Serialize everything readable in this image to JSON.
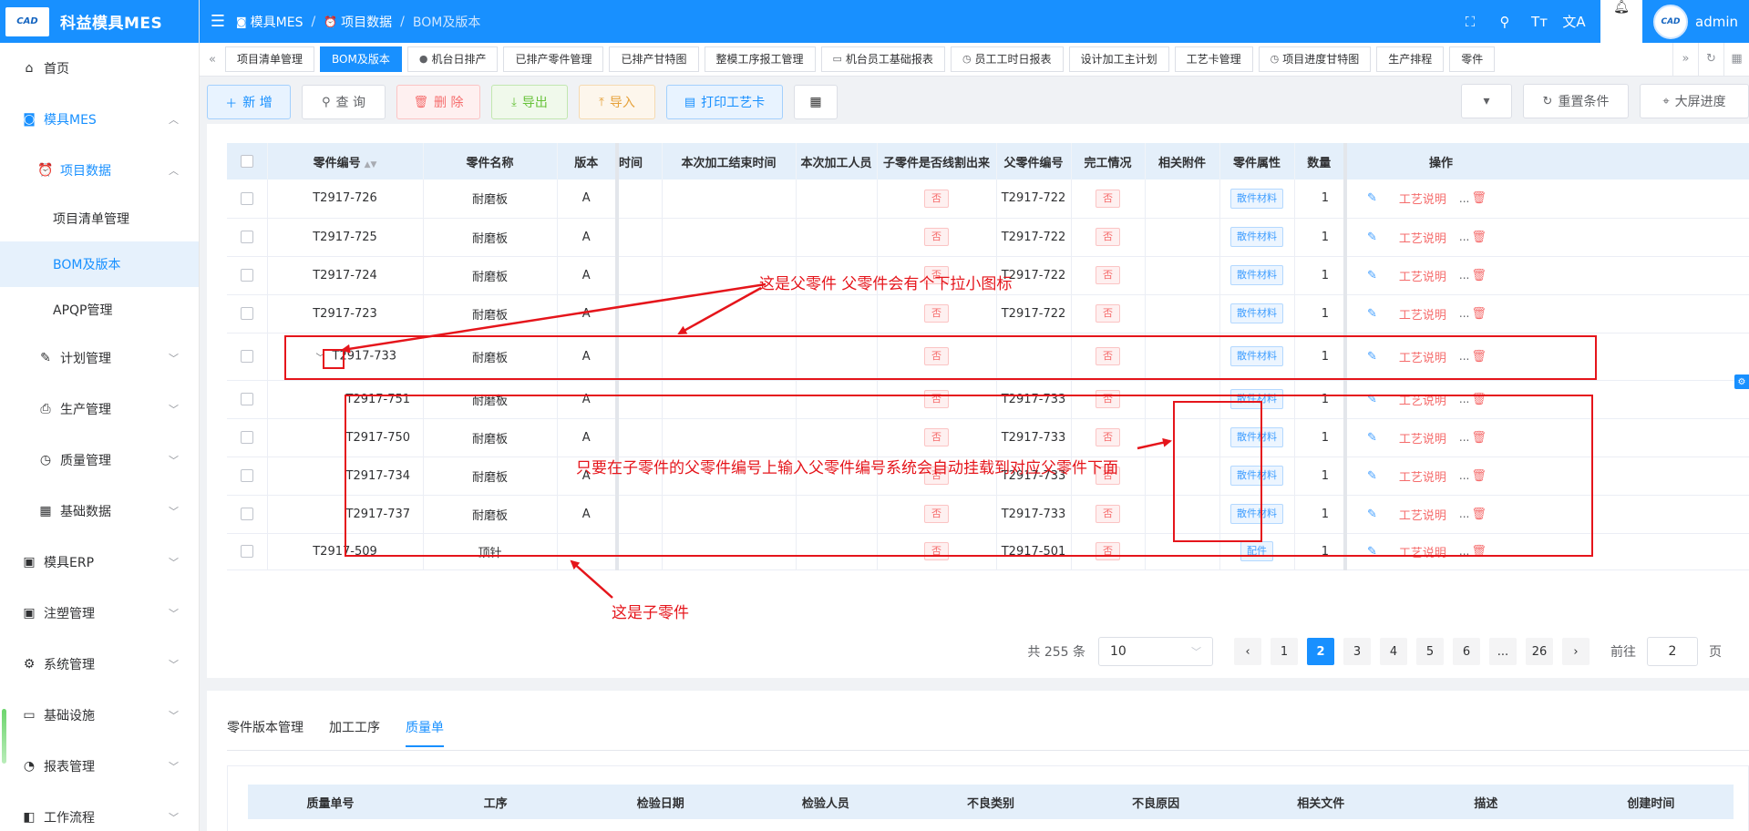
{
  "app": {
    "logo_mark": "CAD",
    "title": "科益模具MES"
  },
  "sidebar": {
    "items": [
      {
        "label": "首页",
        "icon": "home-icon"
      },
      {
        "label": "模具MES",
        "icon": "camera-icon"
      },
      {
        "label": "项目数据",
        "icon": "clock-icon"
      },
      {
        "label": "项目清单管理"
      },
      {
        "label": "BOM及版本"
      },
      {
        "label": "APQP管理"
      },
      {
        "label": "计划管理",
        "icon": "edit-icon"
      },
      {
        "label": "生产管理",
        "icon": "printer-icon"
      },
      {
        "label": "质量管理",
        "icon": "stopwatch-icon"
      },
      {
        "label": "基础数据",
        "icon": "calendar-icon"
      },
      {
        "label": "模具ERP",
        "icon": "briefcase-icon"
      },
      {
        "label": "注塑管理",
        "icon": "briefcase-icon"
      },
      {
        "label": "系统管理",
        "icon": "gear-icon"
      },
      {
        "label": "基础设施",
        "icon": "monitor-icon"
      },
      {
        "label": "报表管理",
        "icon": "pie-chart-icon"
      },
      {
        "label": "工作流程",
        "icon": "workflow-icon"
      }
    ]
  },
  "header": {
    "breadcrumb": [
      "模具MES",
      "项目数据",
      "BOM及版本"
    ],
    "username": "admin",
    "avatar_mark": "CAD"
  },
  "tabs": [
    {
      "label": "项目清单管理"
    },
    {
      "label": "BOM及版本"
    },
    {
      "label": "机台日排产"
    },
    {
      "label": "已排产零件管理"
    },
    {
      "label": "已排产甘特图"
    },
    {
      "label": "整模工序报工管理"
    },
    {
      "label": "机台员工基础报表"
    },
    {
      "label": "员工工时日报表"
    },
    {
      "label": "设计加工主计划"
    },
    {
      "label": "工艺卡管理"
    },
    {
      "label": "项目进度甘特图"
    },
    {
      "label": "生产排程"
    },
    {
      "label": "零件"
    }
  ],
  "toolbar": {
    "add": "新 增",
    "query": "查 询",
    "delete": "删 除",
    "export": "导出",
    "import": "导入",
    "print": "打印工艺卡",
    "reset": "重置条件",
    "screen": "大屏进度"
  },
  "grid": {
    "headers": {
      "partno": "零件编号",
      "name": "零件名称",
      "version": "版本",
      "time_partial": "时间",
      "end_time": "本次加工结束时间",
      "operator": "本次加工人员",
      "cut": "子零件是否线割出来",
      "parent": "父零件编号",
      "done": "完工情况",
      "attach": "相关附件",
      "attr": "零件属性",
      "qty": "数量",
      "ops": "操作"
    },
    "rows": [
      {
        "partno": "T2917-726",
        "name": "耐磨板",
        "version": "A",
        "cut": "否",
        "parent": "T2917-722",
        "done": "否",
        "attr": "散件材料",
        "qty": "1"
      },
      {
        "partno": "T2917-725",
        "name": "耐磨板",
        "version": "A",
        "cut": "否",
        "parent": "T2917-722",
        "done": "否",
        "attr": "散件材料",
        "qty": "1"
      },
      {
        "partno": "T2917-724",
        "name": "耐磨板",
        "version": "A",
        "cut": "否",
        "parent": "T2917-722",
        "done": "否",
        "attr": "散件材料",
        "qty": "1"
      },
      {
        "partno": "T2917-723",
        "name": "耐磨板",
        "version": "A",
        "cut": "否",
        "parent": "T2917-722",
        "done": "否",
        "attr": "散件材料",
        "qty": "1"
      },
      {
        "partno": "T2917-733",
        "name": "耐磨板",
        "version": "A",
        "cut": "否",
        "parent": "",
        "done": "否",
        "attr": "散件材料",
        "qty": "1"
      },
      {
        "partno": "T2917-751",
        "name": "耐磨板",
        "version": "A",
        "cut": "否",
        "parent": "T2917-733",
        "done": "否",
        "attr": "散件材料",
        "qty": "1"
      },
      {
        "partno": "T2917-750",
        "name": "耐磨板",
        "version": "A",
        "cut": "否",
        "parent": "T2917-733",
        "done": "否",
        "attr": "散件材料",
        "qty": "1"
      },
      {
        "partno": "T2917-734",
        "name": "耐磨板",
        "version": "A",
        "cut": "否",
        "parent": "T2917-733",
        "done": "否",
        "attr": "散件材料",
        "qty": "1"
      },
      {
        "partno": "T2917-737",
        "name": "耐磨板",
        "version": "A",
        "cut": "否",
        "parent": "T2917-733",
        "done": "否",
        "attr": "散件材料",
        "qty": "1"
      },
      {
        "partno": "T2917-509",
        "name": "顶针",
        "version": "",
        "cut": "否",
        "parent": "T2917-501",
        "done": "否",
        "attr": "配件",
        "qty": "1"
      }
    ],
    "op_link": "工艺说明",
    "op_more": "..."
  },
  "pagination": {
    "total": "共 255 条",
    "page_size": "10",
    "pages": [
      "1",
      "2",
      "3",
      "4",
      "5",
      "6",
      "...",
      "26"
    ],
    "current": "2",
    "goto_label": "前往",
    "goto_value": "2",
    "page_suffix": "页"
  },
  "bottom": {
    "tabs": [
      "零件版本管理",
      "加工工序",
      "质量单"
    ],
    "active_tab": "质量单",
    "headers": [
      "质量单号",
      "工序",
      "检验日期",
      "检验人员",
      "不良类别",
      "不良原因",
      "相关文件",
      "描述",
      "创建时间"
    ]
  },
  "annotations": {
    "parent_note": "这是父零件 父零件会有个下拉小图标",
    "auto_note": "只要在子零件的父零件编号上输入父零件编号系统会自动挂载到对应父零件下面",
    "child_note": "这是子零件",
    "color": "#e5151b"
  },
  "colors": {
    "primary": "#1890ff",
    "danger": "#f56c6c",
    "success": "#67c23a",
    "warning": "#e6a23c"
  }
}
